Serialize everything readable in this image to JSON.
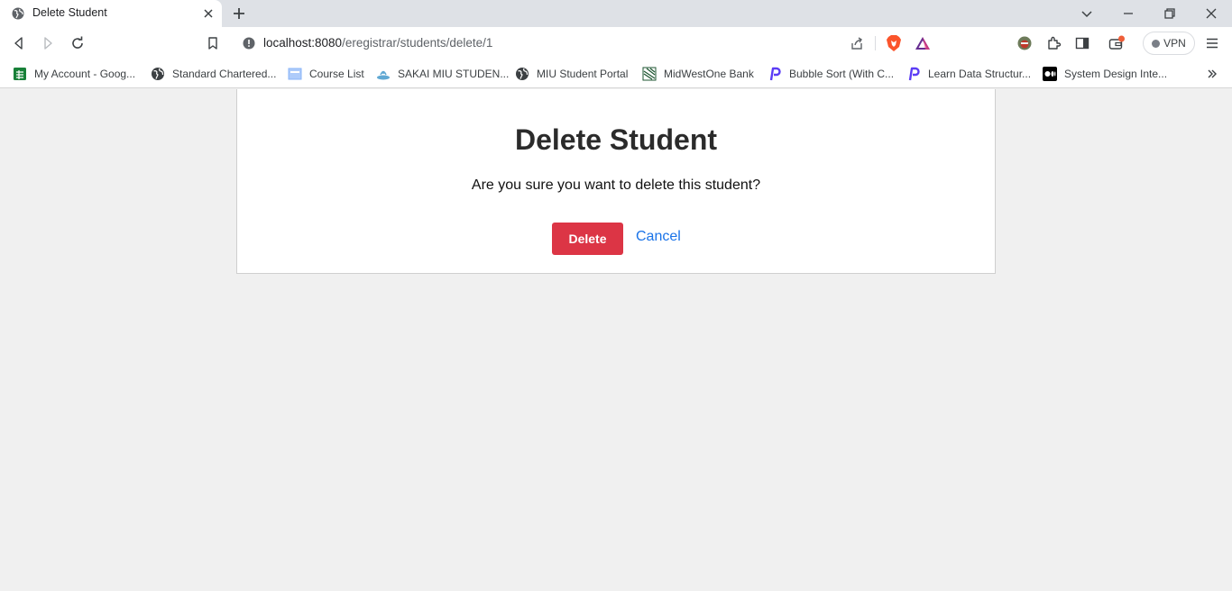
{
  "browser": {
    "tab": {
      "title": "Delete Student"
    },
    "address_bar": {
      "host": "localhost:8080",
      "path": "/eregistrar/students/delete/1"
    },
    "vpn_label": "VPN",
    "bookmarks": [
      {
        "label": "My Account - Goog...",
        "icon": "green-sheet-icon"
      },
      {
        "label": "Standard Chartered...",
        "icon": "globe-icon"
      },
      {
        "label": "Course List",
        "icon": "page-icon"
      },
      {
        "label": "SAKAI MIU STUDEN...",
        "icon": "sakai-icon"
      },
      {
        "label": "MIU Student Portal",
        "icon": "globe-icon"
      },
      {
        "label": "MidWestOne Bank",
        "icon": "bank-icon"
      },
      {
        "label": "Bubble Sort (With C...",
        "icon": "programiz-icon"
      },
      {
        "label": "Learn Data Structur...",
        "icon": "programiz-icon"
      },
      {
        "label": "System Design Inte...",
        "icon": "medium-icon"
      }
    ]
  },
  "page": {
    "title": "Delete Student",
    "message": "Are you sure you want to delete this student?",
    "delete_label": "Delete",
    "cancel_label": "Cancel"
  },
  "colors": {
    "danger": "#dc3545",
    "link": "#1a73e8",
    "page_background": "#f0f0f0"
  }
}
